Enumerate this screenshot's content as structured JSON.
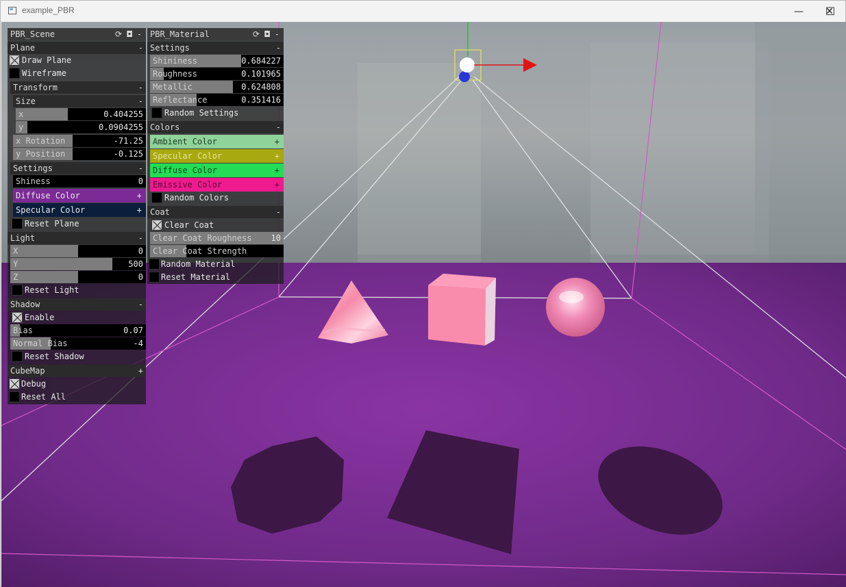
{
  "window": {
    "title": "example_PBR",
    "minimize_glyph": "—",
    "maximize_glyph": "☐",
    "close_glyph": "✕"
  },
  "scene_panel": {
    "title": "PBR_Scene",
    "header_icons": "⟳ ◘ -",
    "plane": {
      "header": "Plane",
      "draw_plane": {
        "label": "Draw Plane",
        "checked": true
      },
      "wireframe": {
        "label": "Wireframe",
        "checked": false
      }
    },
    "transform": {
      "header": "Transform",
      "size_header": "Size",
      "size_x": {
        "label": "x",
        "value": "0.404255",
        "fraction": 0.404255
      },
      "size_y": {
        "label": "y",
        "value": "0.0904255",
        "fraction": 0.09
      },
      "rotation": {
        "label": "x Rotation",
        "value": "-71.25",
        "fraction": 0.45
      },
      "position": {
        "label": "y Position",
        "value": "-0.125",
        "fraction": 0.45
      }
    },
    "settings": {
      "header": "Settings",
      "shininess": {
        "label": "Shiness",
        "value": "0",
        "fraction": 0
      },
      "diffuse_color": {
        "label": "Diffuse Color",
        "color": "#7b2a96"
      },
      "specular_color": {
        "label": "Specular Color",
        "color": "#0b1e3c"
      },
      "reset_plane": {
        "label": "Reset Plane",
        "checked": false
      }
    },
    "light": {
      "header": "Light",
      "x": {
        "label": "X",
        "value": "0",
        "fraction": 0.5
      },
      "y": {
        "label": "Y",
        "value": "500",
        "fraction": 0.75
      },
      "z": {
        "label": "Z",
        "value": "0",
        "fraction": 0.5
      },
      "reset_light": {
        "label": "Reset Light",
        "checked": false
      }
    },
    "shadow": {
      "header": "Shadow",
      "enable": {
        "label": "Enable",
        "checked": true
      },
      "bias": {
        "label": "Bias",
        "value": "0.07",
        "fraction": 0.07
      },
      "normal_bias": {
        "label": "Normal Bias",
        "value": "-4",
        "fraction": 0.3
      },
      "reset_shadow": {
        "label": "Reset Shadow",
        "checked": false
      }
    },
    "cubemap": {
      "header": "CubeMap",
      "header_glyph": "+",
      "debug": {
        "label": "Debug",
        "checked": true
      },
      "reset_all": {
        "label": "Reset All",
        "checked": false
      }
    }
  },
  "material_panel": {
    "title": "PBR_Material",
    "header_icons": "⟳ ◘ -",
    "settings": {
      "header": "Settings",
      "shininess": {
        "label": "Shininess",
        "value": "0.684227",
        "fraction": 0.684227
      },
      "roughness": {
        "label": "Roughness",
        "value": "0.101965",
        "fraction": 0.101965
      },
      "metallic": {
        "label": "Metallic",
        "value": "0.624808",
        "fraction": 0.624808
      },
      "reflectance": {
        "label": "Reflectance",
        "value": "0.351416",
        "fraction": 0.351416
      },
      "random_settings": {
        "label": "Random Settings",
        "checked": false
      }
    },
    "colors": {
      "header": "Colors",
      "ambient": {
        "label": "Ambient Color",
        "color": "#8fd39a"
      },
      "specular": {
        "label": "Specular Color",
        "color": "#a8a810"
      },
      "diffuse": {
        "label": "Diffuse Color",
        "color": "#24dc56"
      },
      "emissive": {
        "label": "Emissive Color",
        "color": "#ee1a8e"
      },
      "random_colors": {
        "label": "Random Colors",
        "checked": false
      }
    },
    "coat": {
      "header": "Coat",
      "clear_coat": {
        "label": "Clear Coat",
        "checked": true
      },
      "clear_coat_roughness": {
        "label": "Clear Coat Roughness",
        "value": "10",
        "fraction": 1.0
      },
      "clear_coat_strength": {
        "label": "Clear Coat Strength",
        "value": "",
        "fraction": 0.27
      },
      "random_material": {
        "label": "Random Material",
        "checked": false
      },
      "reset_material": {
        "label": "Reset Material",
        "checked": false
      }
    }
  }
}
